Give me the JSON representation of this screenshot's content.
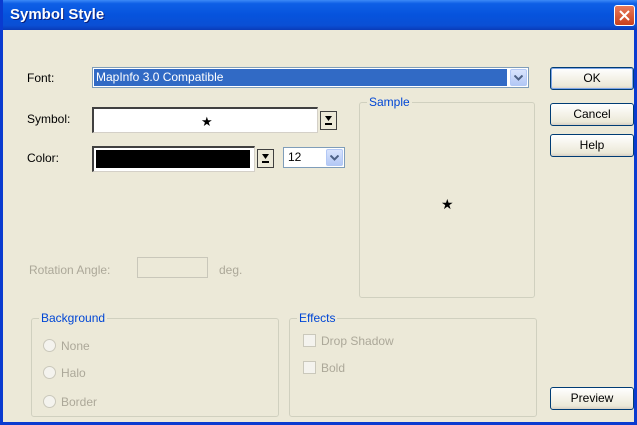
{
  "window": {
    "title": "Symbol Style"
  },
  "font": {
    "label": "Font:",
    "value": "MapInfo 3.0 Compatible"
  },
  "symbol": {
    "label": "Symbol:",
    "value": "★"
  },
  "color": {
    "label": "Color:",
    "swatch_color": "#000000"
  },
  "size": {
    "value": "12"
  },
  "rotation": {
    "label": "Rotation Angle:",
    "value": "",
    "unit": "deg."
  },
  "sample": {
    "label": "Sample",
    "glyph": "★"
  },
  "buttons": {
    "ok": "OK",
    "cancel": "Cancel",
    "help": "Help",
    "preview": "Preview"
  },
  "background": {
    "label": "Background",
    "options": [
      "None",
      "Halo",
      "Border"
    ]
  },
  "effects": {
    "label": "Effects",
    "options": [
      "Drop Shadow",
      "Bold"
    ]
  },
  "colors": {
    "titlebar": "#0653dd",
    "face": "#ece9d8",
    "selection": "#316ac5",
    "group_label": "#0046d5",
    "disabled_text": "#aca899"
  }
}
